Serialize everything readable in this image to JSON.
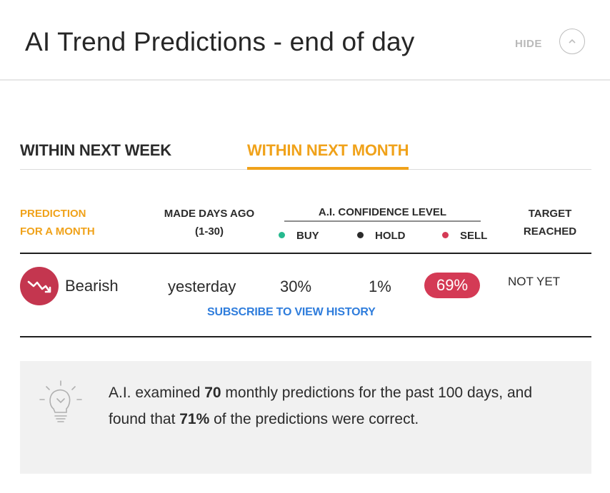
{
  "header": {
    "title": "AI Trend Predictions - end of day",
    "hide_label": "HIDE",
    "collapse_icon": "chevron-up-icon"
  },
  "tabs": [
    {
      "label": "WITHIN NEXT WEEK",
      "active": false
    },
    {
      "label": "WITHIN NEXT MONTH",
      "active": true
    }
  ],
  "table": {
    "headers": {
      "prediction": [
        "PREDICTION",
        "FOR A MONTH"
      ],
      "made_days_ago": [
        "MADE DAYS AGO",
        "(1-30)"
      ],
      "confidence": "A.I. CONFIDENCE LEVEL",
      "buy": "BUY",
      "hold": "HOLD",
      "sell": "SELL",
      "target": [
        "TARGET",
        "REACHED"
      ]
    },
    "row": {
      "prediction": "Bearish",
      "made": "yesterday",
      "buy": "30%",
      "hold": "1%",
      "sell": "69%",
      "target": "NOT YET"
    },
    "subscribe_label": "SUBSCRIBE TO VIEW HISTORY"
  },
  "insight": {
    "t1": "A.I. examined ",
    "n1": "70",
    "t2": " monthly predictions for the past 100 days, and found that ",
    "n2": "71%",
    "t3": " of the predictions were correct."
  },
  "colors": {
    "accent": "#f0a21a",
    "buy": "#26b98e",
    "hold": "#2b2b2b",
    "sell": "#d43a55",
    "link": "#2f7ddc"
  }
}
